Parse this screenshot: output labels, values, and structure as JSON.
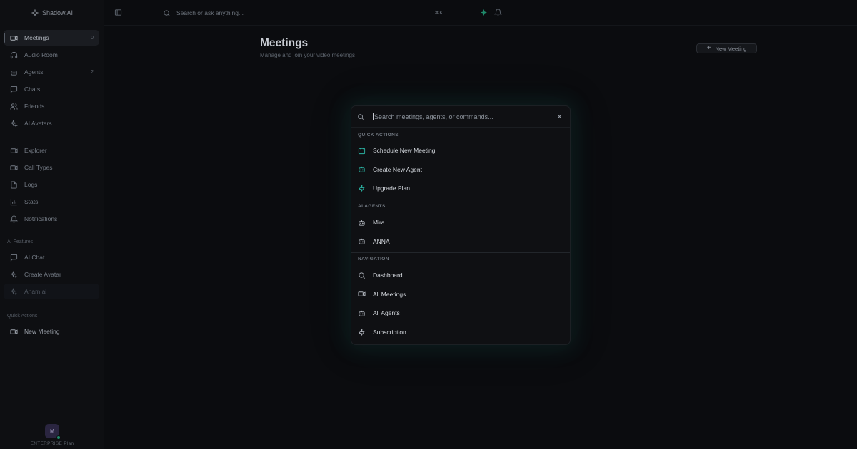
{
  "app": {
    "name": "Shadow.AI"
  },
  "sidebar": {
    "main_items": [
      {
        "label": "Meetings",
        "count": "0",
        "icon": "video-icon",
        "active": true
      },
      {
        "label": "Audio Room",
        "count": "",
        "icon": "headphones-icon"
      },
      {
        "label": "Agents",
        "count": "2",
        "icon": "bot-icon"
      },
      {
        "label": "Chats",
        "count": "",
        "icon": "chat-icon"
      },
      {
        "label": "Friends",
        "count": "",
        "icon": "users-icon"
      },
      {
        "label": "AI Avatars",
        "count": "",
        "icon": "sparkles-icon"
      }
    ],
    "secondary_items": [
      {
        "label": "Explorer",
        "icon": "compass-icon"
      },
      {
        "label": "Call Types",
        "icon": "video-icon"
      },
      {
        "label": "Logs",
        "icon": "file-icon"
      },
      {
        "label": "Stats",
        "icon": "chart-icon"
      },
      {
        "label": "Notifications",
        "icon": "bell-icon"
      }
    ],
    "ai_features_label": "AI Features",
    "ai_items": [
      {
        "label": "AI Chat",
        "icon": "chat-icon"
      },
      {
        "label": "Create Avatar",
        "icon": "sparkles-icon"
      },
      {
        "label": "Anam.ai",
        "icon": "sparkles-icon"
      }
    ],
    "quick_actions_label": "Quick Actions",
    "quick_items": [
      {
        "label": "New Meeting",
        "icon": "video-icon"
      }
    ],
    "user": {
      "initial": "M",
      "plan": "ENTERPRISE Plan"
    }
  },
  "topbar": {
    "search_placeholder": "Search or ask anything...",
    "shortcut": "⌘K"
  },
  "page": {
    "title": "Meetings",
    "subtitle": "Manage and join your video meetings",
    "new_meeting_label": "New Meeting"
  },
  "palette": {
    "placeholder": "Search meetings, agents, or commands...",
    "groups": [
      {
        "label": "QUICK ACTIONS",
        "items": [
          {
            "label": "Schedule New Meeting",
            "icon": "calendar-icon"
          },
          {
            "label": "Create New Agent",
            "icon": "bot-icon"
          },
          {
            "label": "Upgrade Plan",
            "icon": "zap-icon"
          }
        ]
      },
      {
        "label": "AI AGENTS",
        "items": [
          {
            "label": "Mira",
            "icon": "bot-icon"
          },
          {
            "label": "ANNA",
            "icon": "bot-icon"
          }
        ]
      },
      {
        "label": "NAVIGATION",
        "items": [
          {
            "label": "Dashboard",
            "icon": "search-icon"
          },
          {
            "label": "All Meetings",
            "icon": "video-icon"
          },
          {
            "label": "All Agents",
            "icon": "bot-icon"
          },
          {
            "label": "Subscription",
            "icon": "zap-icon"
          }
        ]
      }
    ]
  },
  "colors": {
    "background": "#0b0c0f",
    "sidebar": "#0e0f12",
    "accent_teal": "#2bb3a3",
    "status_green": "#1f8a6a"
  }
}
